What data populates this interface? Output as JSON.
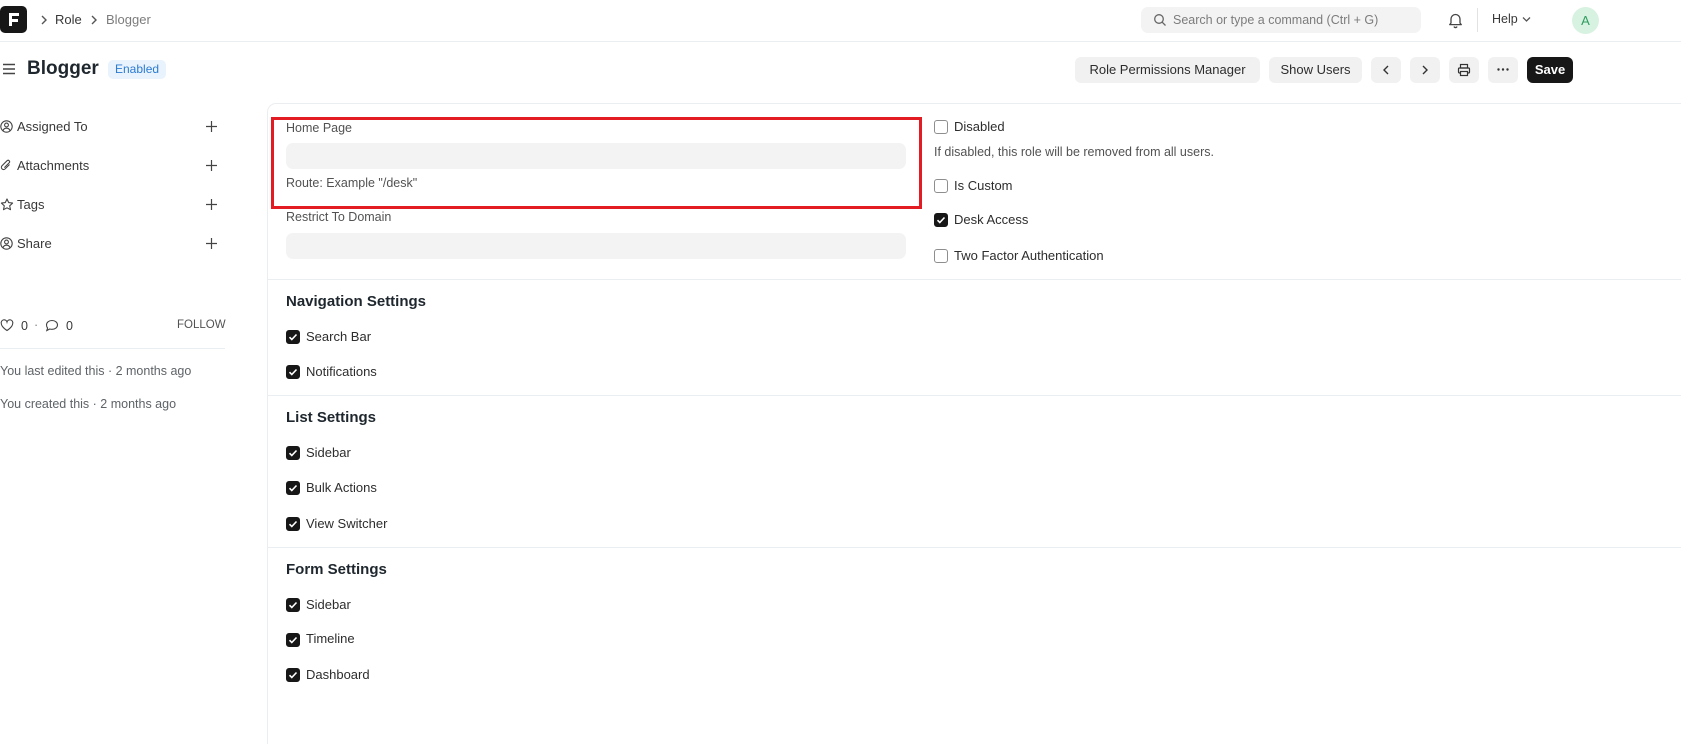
{
  "breadcrumb": {
    "items": [
      "Role",
      "Blogger"
    ]
  },
  "navbar": {
    "search_placeholder": "Search or type a command (Ctrl + G)",
    "help_label": "Help",
    "avatar_initial": "A"
  },
  "page": {
    "title": "Blogger",
    "status": "Enabled",
    "actions": {
      "role_permissions_manager": "Role Permissions Manager",
      "show_users": "Show Users",
      "save": "Save"
    }
  },
  "sidebar": {
    "items": [
      {
        "label": "Assigned To",
        "icon": "user-assign-icon"
      },
      {
        "label": "Attachments",
        "icon": "paperclip-icon"
      },
      {
        "label": "Tags",
        "icon": "star-icon"
      },
      {
        "label": "Share",
        "icon": "share-user-icon"
      }
    ],
    "likes": "0",
    "comments": "0",
    "follow": "FOLLOW",
    "last_edited": "You last edited this · 2 months ago",
    "created": "You created this · 2 months ago"
  },
  "form": {
    "home_page": {
      "label": "Home Page",
      "value": "",
      "description": "Route: Example \"/desk\""
    },
    "restrict_to_domain": {
      "label": "Restrict To Domain",
      "value": ""
    },
    "disabled": {
      "label": "Disabled",
      "checked": false,
      "description": "If disabled, this role will be removed from all users."
    },
    "is_custom": {
      "label": "Is Custom",
      "checked": false
    },
    "desk_access": {
      "label": "Desk Access",
      "checked": true
    },
    "two_factor": {
      "label": "Two Factor Authentication",
      "checked": false
    },
    "navigation_settings": {
      "title": "Navigation Settings",
      "fields": [
        {
          "label": "Search Bar",
          "checked": true
        },
        {
          "label": "Notifications",
          "checked": true
        }
      ]
    },
    "list_settings": {
      "title": "List Settings",
      "fields": [
        {
          "label": "Sidebar",
          "checked": true
        },
        {
          "label": "Bulk Actions",
          "checked": true
        },
        {
          "label": "View Switcher",
          "checked": true
        }
      ]
    },
    "form_settings": {
      "title": "Form Settings",
      "fields": [
        {
          "label": "Sidebar",
          "checked": true
        },
        {
          "label": "Timeline",
          "checked": true
        },
        {
          "label": "Dashboard",
          "checked": true
        }
      ]
    }
  },
  "colors": {
    "highlight": "#e31b23",
    "primary": "#171717",
    "badge_text": "#2b7bd2",
    "badge_bg": "#e9f3fd"
  }
}
